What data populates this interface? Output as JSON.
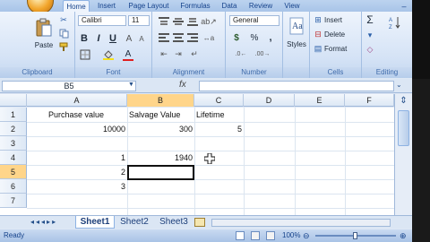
{
  "ribbon": {
    "tabs": [
      "Home",
      "Insert",
      "Page Layout",
      "Formulas",
      "Data",
      "Review",
      "View"
    ],
    "clipboard": {
      "paste_label": "Paste",
      "group_label": "Clipboard"
    },
    "font": {
      "name": "Calibri",
      "size": "11",
      "bold": "B",
      "italic": "I",
      "underline": "U",
      "group_label": "Font"
    },
    "alignment": {
      "group_label": "Alignment"
    },
    "number": {
      "format": "General",
      "currency": "$",
      "percent": "%",
      "comma": ",",
      "group_label": "Number"
    },
    "styles": {
      "label": "Styles"
    },
    "cells": {
      "insert_label": "Insert",
      "delete_label": "Delete",
      "format_label": "Format",
      "group_label": "Cells"
    },
    "editing": {
      "sum": "Σ",
      "group_label": "Editing"
    }
  },
  "formula_bar": {
    "name_box": "B5",
    "fx_label": "fx",
    "content": ""
  },
  "columns": [
    "A",
    "B",
    "C",
    "D",
    "E",
    "F"
  ],
  "rows": [
    "1",
    "2",
    "3",
    "4",
    "5",
    "6",
    "7"
  ],
  "cells": {
    "A1": "Purchase value",
    "B1": "Salvage Value",
    "C1": "Lifetime",
    "A2": "10000",
    "B2": "300",
    "C2": "5",
    "A4": "1",
    "B4": "1940",
    "A5": "2",
    "A6": "3"
  },
  "sheet_tabs": [
    "Sheet1",
    "Sheet2",
    "Sheet3"
  ],
  "status": {
    "ready": "Ready",
    "zoom": "100%"
  }
}
